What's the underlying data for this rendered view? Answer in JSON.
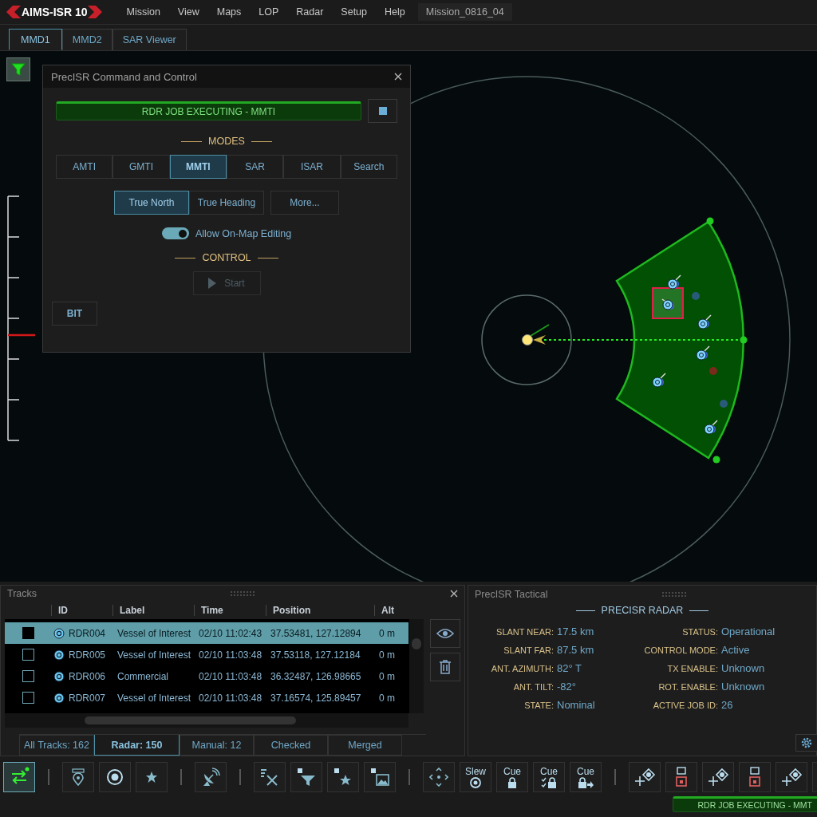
{
  "app": {
    "logo": "AIMS-ISR 10",
    "menu": [
      "Mission",
      "View",
      "Maps",
      "LOP",
      "Radar",
      "Setup",
      "Help"
    ],
    "mission": "Mission_0816_04"
  },
  "tabs": [
    {
      "label": "MMD1",
      "selected": true
    },
    {
      "label": "MMD2",
      "selected": false
    },
    {
      "label": "SAR Viewer",
      "selected": false
    }
  ],
  "command_dialog": {
    "title": "PrecISR Command and Control",
    "job_status": "RDR JOB EXECUTING - MMTI",
    "modes_heading": "MODES",
    "modes": [
      {
        "label": "AMTI",
        "selected": false
      },
      {
        "label": "GMTI",
        "selected": false
      },
      {
        "label": "MMTI",
        "selected": true
      },
      {
        "label": "SAR",
        "selected": false
      },
      {
        "label": "ISAR",
        "selected": false
      },
      {
        "label": "Search",
        "selected": false
      }
    ],
    "orientation": [
      {
        "label": "True North",
        "selected": true
      },
      {
        "label": "True Heading",
        "selected": false
      }
    ],
    "more": "More...",
    "editing_toggle": {
      "label": "Allow On-Map Editing",
      "on": true
    },
    "control_heading": "CONTROL",
    "start": {
      "label": "Start",
      "disabled": true
    },
    "bit": "BIT"
  },
  "tracks": {
    "title": "Tracks",
    "columns": [
      "ID",
      "Label",
      "Time",
      "Position",
      "Alt"
    ],
    "rows": [
      {
        "checked": true,
        "selected": true,
        "id": "RDR004",
        "label": "Vessel of Interest",
        "time": "02/10 11:02:43",
        "position": "37.53481, 127.12894",
        "alt": "0 m"
      },
      {
        "checked": false,
        "selected": false,
        "id": "RDR005",
        "label": "Vessel of Interest",
        "time": "02/10 11:03:48",
        "position": "37.53118, 127.12184",
        "alt": "0 m"
      },
      {
        "checked": false,
        "selected": false,
        "id": "RDR006",
        "label": "Commercial",
        "time": "02/10 11:03:48",
        "position": "36.32487, 126.98665",
        "alt": "0 m"
      },
      {
        "checked": false,
        "selected": false,
        "id": "RDR007",
        "label": "Vessel of Interest",
        "time": "02/10 11:03:48",
        "position": "37.16574, 125.89457",
        "alt": "0 m"
      }
    ],
    "filters": [
      {
        "label": "All Tracks: 162",
        "selected": false
      },
      {
        "label": "Radar: 150",
        "selected": true
      },
      {
        "label": "Manual: 12",
        "selected": false
      },
      {
        "label": "Checked",
        "selected": false
      },
      {
        "label": "Merged",
        "selected": false
      }
    ]
  },
  "tactical": {
    "title": "PrecISR Tactical",
    "heading": "PRECISR RADAR",
    "left": [
      {
        "label": "SLANT NEAR:",
        "value": "17.5 km"
      },
      {
        "label": "SLANT FAR:",
        "value": "87.5 km"
      },
      {
        "label": "ANT. AZIMUTH:",
        "value": "82° T"
      },
      {
        "label": "ANT. TILT:",
        "value": "-82°"
      },
      {
        "label": "STATE:",
        "value": "Nominal"
      }
    ],
    "right": [
      {
        "label": "STATUS:",
        "value": "Operational"
      },
      {
        "label": "CONTROL MODE:",
        "value": "Active"
      },
      {
        "label": "TX ENABLE:",
        "value": "Unknown"
      },
      {
        "label": "ROT. ENABLE:",
        "value": "Unknown"
      },
      {
        "label": "ACTIVE JOB ID:",
        "value": "26"
      }
    ]
  },
  "toolbar": {
    "text_buttons": [
      "Slew",
      "Cue",
      "Cue",
      "Cue"
    ]
  },
  "status_bar": {
    "job_status": "RDR JOB EXECUTING - MMT"
  }
}
